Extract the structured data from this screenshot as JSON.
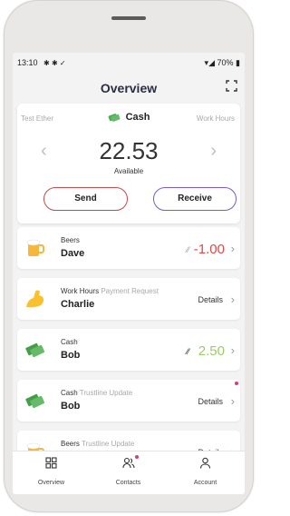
{
  "status": {
    "time": "13:10",
    "left_icons": "✱ ✱ ✓",
    "battery": "70%"
  },
  "header": {
    "title": "Overview"
  },
  "wallet": {
    "prev_token": "Test Ether",
    "current_token": "Cash",
    "next_token": "Work Hours",
    "amount": "22.53",
    "available_label": "Available",
    "send_label": "Send",
    "receive_label": "Receive"
  },
  "activity": [
    {
      "type": "Beers",
      "extra": "",
      "name": "Dave",
      "amount": "-1.00",
      "amount_color": "#e04848",
      "icon": "beer-icon"
    },
    {
      "type": "Work Hours",
      "extra": "Payment Request",
      "name": "Charlie",
      "action": "Details",
      "icon": "flexed-arm-icon"
    },
    {
      "type": "Cash",
      "extra": "",
      "name": "Bob",
      "amount": "2.50",
      "amount_color": "#9ccc65",
      "icon": "money-icon"
    },
    {
      "type": "Cash",
      "extra": "Trustline Update",
      "name": "Bob",
      "action": "Details",
      "icon": "money-icon"
    },
    {
      "type": "Beers",
      "extra": "Trustline Update",
      "name": "",
      "action": "Details",
      "icon": "beer-icon"
    }
  ],
  "nav": [
    {
      "label": "Overview",
      "icon": "grid-icon"
    },
    {
      "label": "Contacts",
      "icon": "people-icon"
    },
    {
      "label": "Account",
      "icon": "person-icon"
    }
  ]
}
